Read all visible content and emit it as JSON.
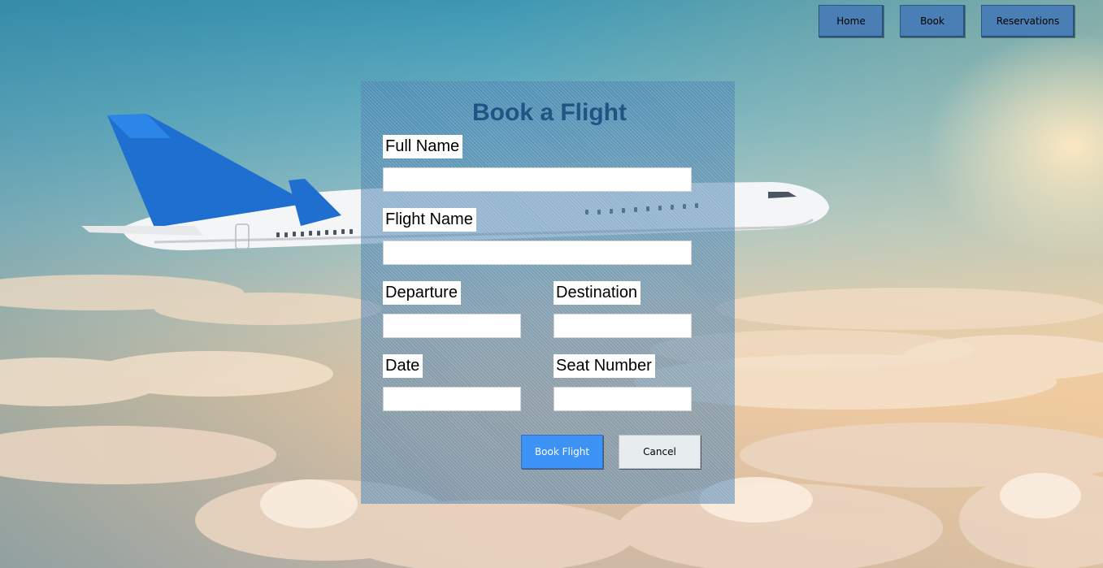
{
  "nav": {
    "home_label": "Home",
    "book_label": "Book",
    "reservations_label": "Reservations"
  },
  "form": {
    "title": "Book a Flight",
    "full_name": {
      "label": "Full Name",
      "value": ""
    },
    "flight_name": {
      "label": "Flight Name",
      "value": ""
    },
    "departure": {
      "label": "Departure",
      "value": ""
    },
    "destination": {
      "label": "Destination",
      "value": ""
    },
    "date": {
      "label": "Date",
      "value": ""
    },
    "seat_number": {
      "label": "Seat Number",
      "value": ""
    },
    "book_label": "Book Flight",
    "cancel_label": "Cancel"
  },
  "colors": {
    "nav_button": "#4a7fb5",
    "title": "#1f5485",
    "book_button": "#3d93f5",
    "cancel_button": "#e7ecef",
    "plane_tail": "#1f6fd1"
  }
}
